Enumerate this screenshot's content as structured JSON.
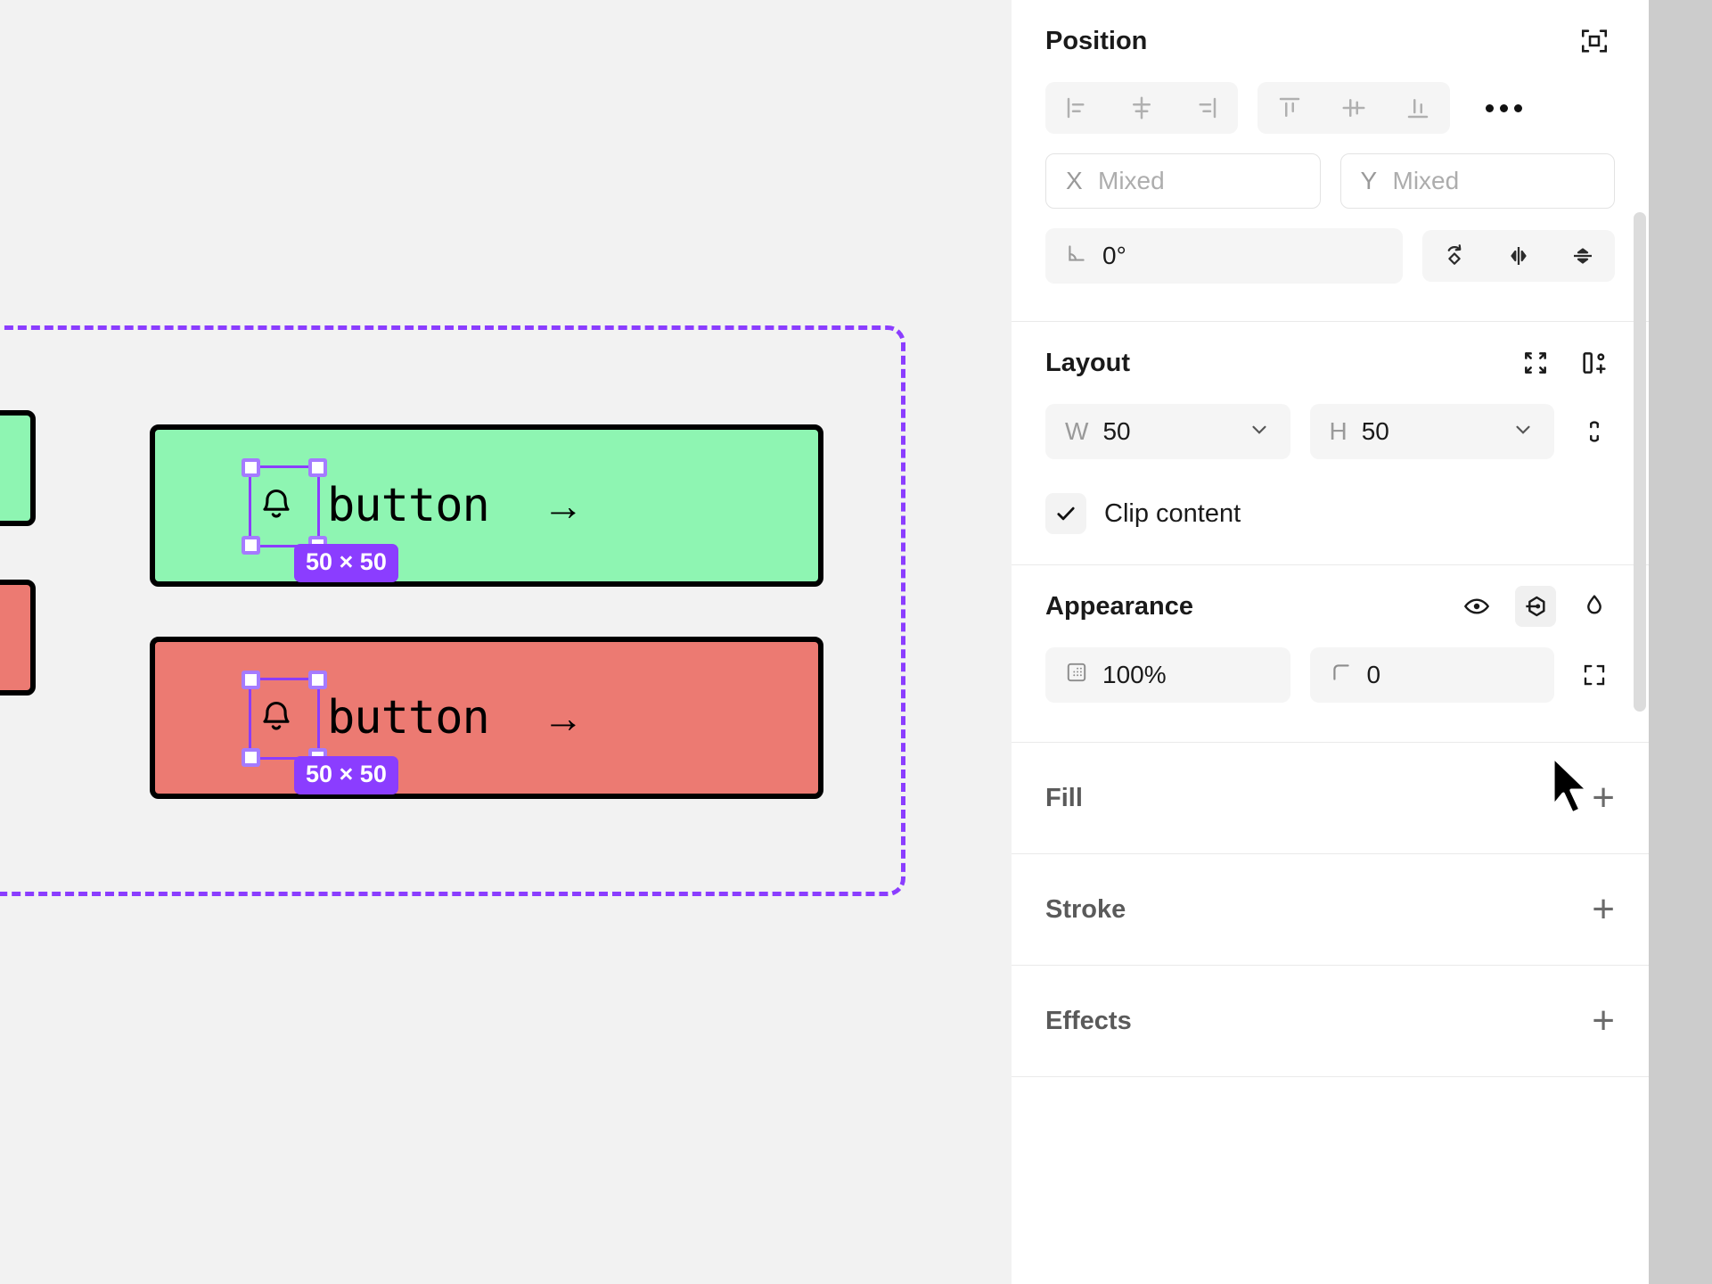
{
  "canvas": {
    "selection_badge_green": "50 × 50",
    "selection_badge_red": "50 × 50",
    "button_green_label": "button",
    "button_green_arrow": "→",
    "button_red_label": "button",
    "button_red_arrow": "→",
    "colors": {
      "green_fill": "#8ef5b2",
      "red_fill": "#ec7a72",
      "selection_purple": "#8b3dff",
      "canvas_bg": "#f2f2f2",
      "stroke_black": "#000000"
    }
  },
  "panel": {
    "position": {
      "title": "Position",
      "frame_icon": "absolute-position-icon",
      "align_icons": [
        "align-left-icon",
        "align-center-horizontal-icon",
        "align-right-icon"
      ],
      "valign_icons": [
        "align-top-icon",
        "align-center-vertical-icon",
        "align-bottom-icon"
      ],
      "more_icon": "more-options-icon",
      "x_label": "X",
      "x_value": "Mixed",
      "y_label": "Y",
      "y_value": "Mixed",
      "rotation_value": "0°",
      "rotation_icon": "angle-icon",
      "transform_icons": [
        "rotate-icon",
        "flip-horizontal-icon",
        "flip-vertical-icon"
      ]
    },
    "layout": {
      "title": "Layout",
      "header_icons": [
        "collapse-inward-icon",
        "add-auto-layout-icon"
      ],
      "w_label": "W",
      "w_value": "50",
      "h_label": "H",
      "h_value": "50",
      "link_icon": "link-dimensions-icon",
      "clip_label": "Clip content",
      "clip_checked": true
    },
    "appearance": {
      "title": "Appearance",
      "header_icons": [
        "visibility-eye-icon",
        "hug-contents-icon",
        "blend-drop-icon"
      ],
      "opacity_icon": "opacity-icon",
      "opacity_value": "100%",
      "corner_icon": "corner-radius-icon",
      "corner_value": "0",
      "independent_corners_icon": "independent-corners-icon"
    },
    "fill": {
      "title": "Fill",
      "add": "+"
    },
    "stroke": {
      "title": "Stroke",
      "add": "+"
    },
    "effects": {
      "title": "Effects",
      "add": "+"
    }
  }
}
